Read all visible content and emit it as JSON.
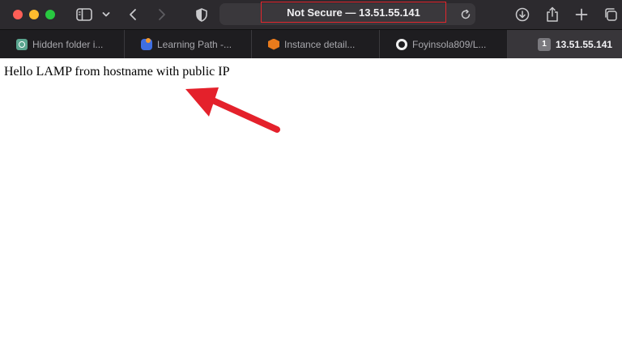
{
  "address_bar": {
    "text": "Not Secure — 13.51.55.141"
  },
  "tabs": [
    {
      "label": "Hidden folder i...",
      "icon": "chatgpt-icon"
    },
    {
      "label": "Learning Path -...",
      "icon": "learning-path-icon"
    },
    {
      "label": "Instance detail...",
      "icon": "aws-icon"
    },
    {
      "label": "Foyinsola809/L...",
      "icon": "github-icon"
    },
    {
      "label": "13.51.55.141",
      "badge": "1",
      "active": true
    }
  ],
  "page": {
    "body_text": "Hello LAMP from hostname with public IP"
  },
  "colors": {
    "annotation_arrow": "#e4212b",
    "address_highlight": "#e3262d"
  }
}
